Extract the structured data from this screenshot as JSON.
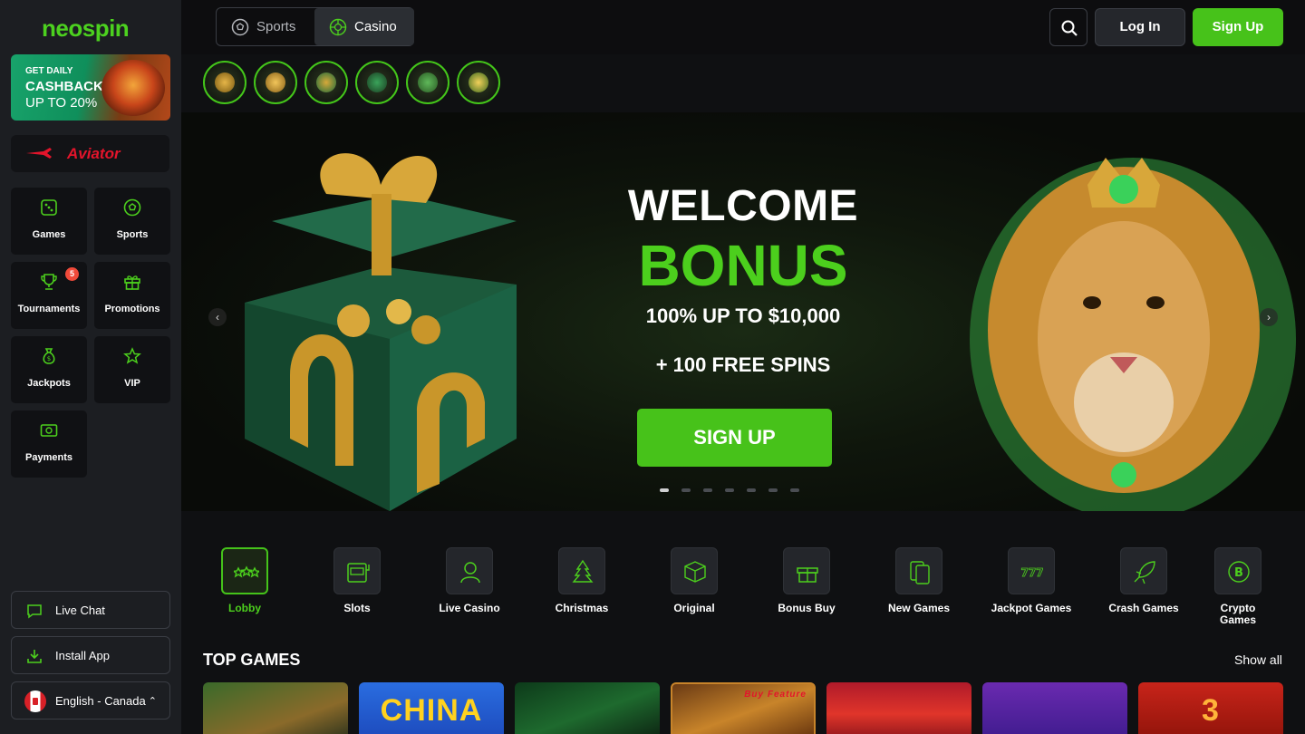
{
  "logo": {
    "part1": "neo",
    "part2": "spin"
  },
  "promo_banner": {
    "line1": "GET DAILY",
    "line2": "CASHBACK",
    "line3": "UP TO 20%"
  },
  "aviator": {
    "label": "Aviator"
  },
  "nav_tiles": [
    {
      "label": "Games",
      "icon": "dice-icon"
    },
    {
      "label": "Sports",
      "icon": "soccer-ball-icon"
    },
    {
      "label": "Tournaments",
      "icon": "trophy-icon",
      "badge": "5"
    },
    {
      "label": "Promotions",
      "icon": "gift-icon"
    },
    {
      "label": "Jackpots",
      "icon": "money-bag-icon"
    },
    {
      "label": "VIP",
      "icon": "star-icon"
    },
    {
      "label": "Payments",
      "icon": "cash-icon"
    }
  ],
  "sidebar_buttons": {
    "live_chat": "Live Chat",
    "install_app": "Install App",
    "language": "English - Canada"
  },
  "topbar": {
    "sports": "Sports",
    "casino": "Casino",
    "login": "Log In",
    "signup": "Sign Up"
  },
  "hero": {
    "title1": "WELCOME",
    "title2": "BONUS",
    "line1": "100% UP TO $10,000",
    "line2": "+ 100 FREE SPINS",
    "cta": "SIGN UP",
    "slide_count": 7,
    "active_slide": 1
  },
  "categories": [
    {
      "label": "Lobby",
      "icon": "stars-icon",
      "active": true
    },
    {
      "label": "Slots",
      "icon": "slot-machine-icon"
    },
    {
      "label": "Live Casino",
      "icon": "dealer-icon"
    },
    {
      "label": "Christmas",
      "icon": "christmas-tree-icon"
    },
    {
      "label": "Original",
      "icon": "dice-cube-icon"
    },
    {
      "label": "Bonus Buy",
      "icon": "gift-box-icon"
    },
    {
      "label": "New Games",
      "icon": "cards-icon"
    },
    {
      "label": "Jackpot Games",
      "icon": "triple-seven-icon"
    },
    {
      "label": "Crash Games",
      "icon": "rocket-icon"
    },
    {
      "label": "Crypto Games",
      "icon": "bitcoin-icon"
    }
  ],
  "top_games": {
    "title": "TOP GAMES",
    "show_all": "Show all",
    "games": [
      {
        "title": ""
      },
      {
        "title": "CHINA"
      },
      {
        "title": ""
      },
      {
        "title": "Buy Feature"
      },
      {
        "title": ""
      },
      {
        "title": ""
      },
      {
        "title": "3"
      }
    ]
  },
  "colors": {
    "accent": "#47c21a",
    "accent_text": "#4ccf1d",
    "sidebar_bg": "#1c1e22",
    "badge": "#f04a3a",
    "aviator": "#e3142b"
  }
}
